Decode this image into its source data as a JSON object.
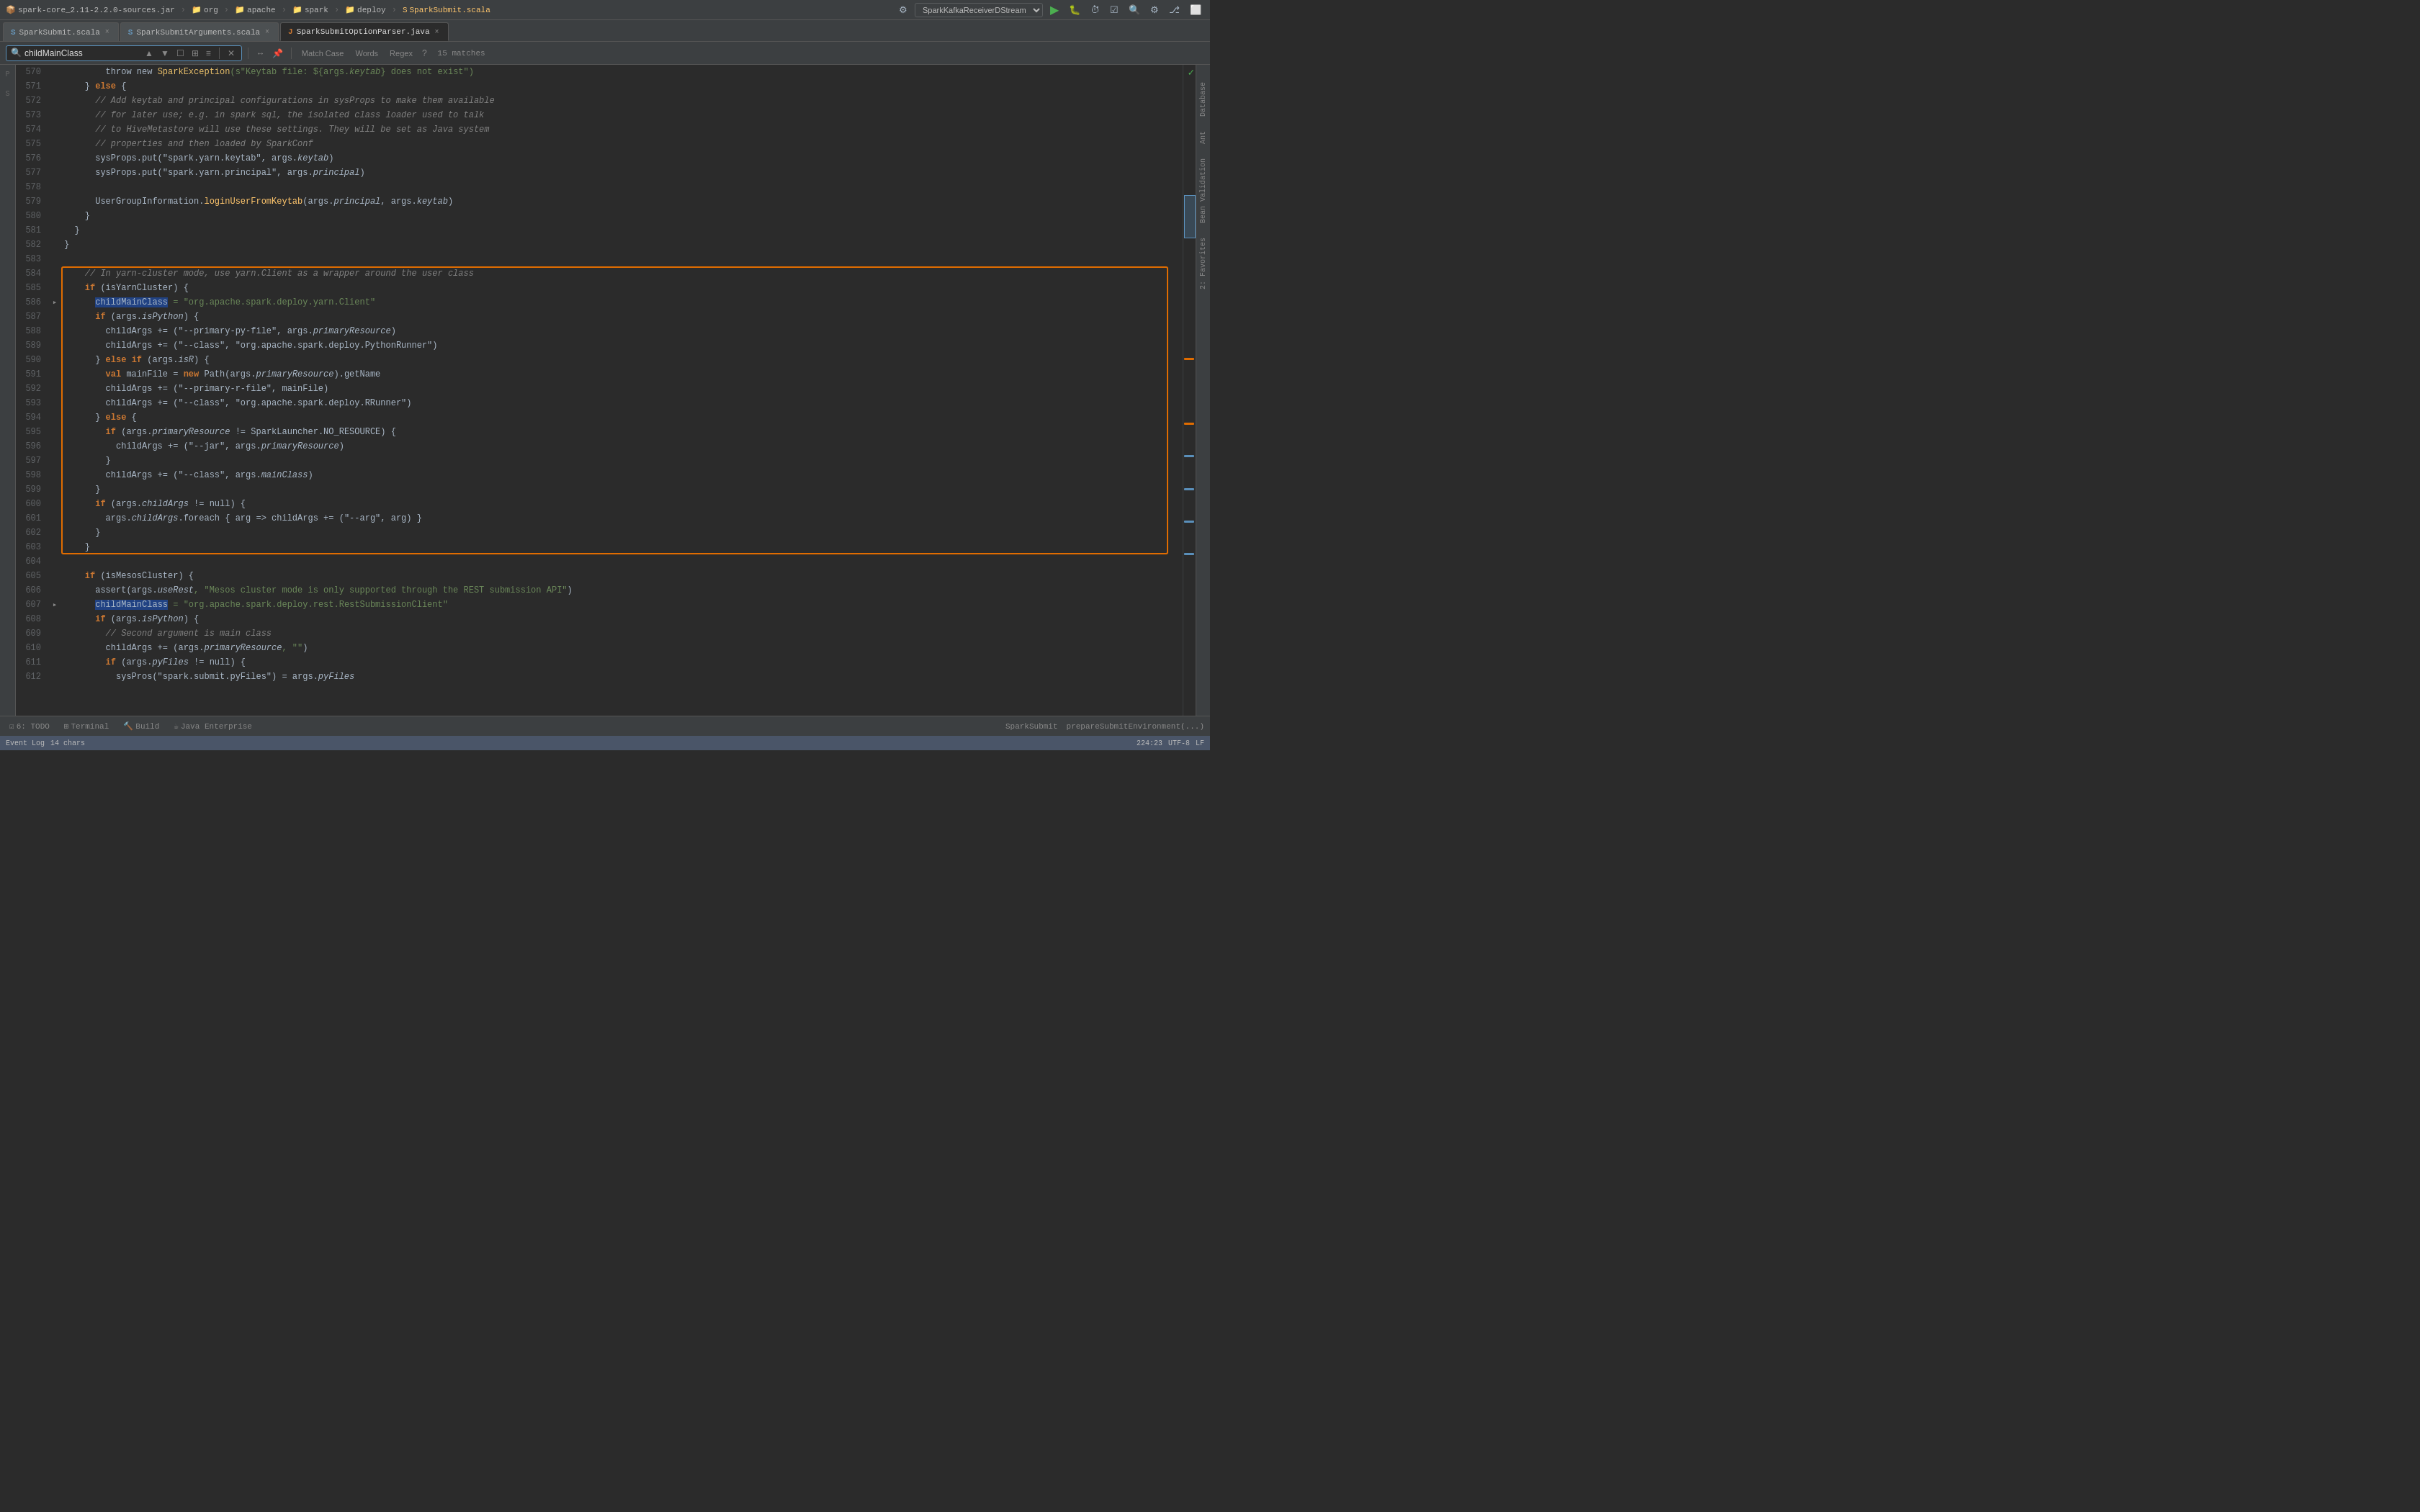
{
  "topbar": {
    "breadcrumbs": [
      {
        "label": "spark-core_2.11-2.2.0-sources.jar",
        "icon": "jar"
      },
      {
        "label": "org",
        "icon": "folder"
      },
      {
        "label": "apache",
        "icon": "folder"
      },
      {
        "label": "spark",
        "icon": "folder"
      },
      {
        "label": "deploy",
        "icon": "folder"
      },
      {
        "label": "SparkSubmit.scala",
        "icon": "scala"
      }
    ],
    "run_config": "SparkKafkaReceiverDStream"
  },
  "tabs": [
    {
      "label": "SparkSubmit.scala",
      "active": false,
      "icon": "S"
    },
    {
      "label": "SparkSubmitArguments.scala",
      "active": false,
      "icon": "S"
    },
    {
      "label": "SparkSubmitOptionParser.java",
      "active": true,
      "icon": "J"
    }
  ],
  "search": {
    "query": "childMainClass",
    "placeholder": "childMainClass",
    "match_case_label": "Match Case",
    "words_label": "Words",
    "regex_label": "Regex",
    "regex_help": "?",
    "matches": "15 matches"
  },
  "lines": [
    {
      "num": 570,
      "fold": false,
      "code": [
        {
          "t": "        throw new ",
          "c": "id"
        },
        {
          "t": "SparkException",
          "c": "cls"
        },
        {
          "t": "(s\"Keytab file: ${args.",
          "c": "str"
        },
        {
          "t": "keytab",
          "c": "it str"
        },
        {
          "t": "} does not exist\")",
          "c": "str"
        }
      ]
    },
    {
      "num": 571,
      "fold": false,
      "code": [
        {
          "t": "    } else {",
          "c": "id"
        }
      ]
    },
    {
      "num": 572,
      "fold": false,
      "code": [
        {
          "t": "      // Add keytab and principal configurations in sysProps to make them available",
          "c": "cm"
        }
      ]
    },
    {
      "num": 573,
      "fold": false,
      "code": [
        {
          "t": "      // for later use; e.g. in spark sql, the isolated class loader used to talk",
          "c": "cm"
        }
      ]
    },
    {
      "num": 574,
      "fold": false,
      "code": [
        {
          "t": "      // to HiveMetastore will use these settings. They will be set as Java system",
          "c": "cm"
        }
      ]
    },
    {
      "num": 575,
      "fold": false,
      "code": [
        {
          "t": "      // properties and then loaded by SparkConf",
          "c": "cm"
        }
      ]
    },
    {
      "num": 576,
      "fold": false,
      "code": [
        {
          "t": "      sysProps.put(\"spark.yarn.keytab\", args.",
          "c": "id"
        },
        {
          "t": "keytab",
          "c": "it"
        }
      ],
      "extra": "keytab"
    },
    {
      "num": 577,
      "fold": false,
      "code": [
        {
          "t": "      sysProps.put(\"spark.yarn.principal\", args.",
          "c": "id"
        },
        {
          "t": "principal",
          "c": "it"
        }
      ],
      "extra": "principal"
    },
    {
      "num": 578,
      "fold": false,
      "code": []
    },
    {
      "num": 579,
      "fold": false,
      "code": [
        {
          "t": "      UserGroupInformation.",
          "c": "id"
        },
        {
          "t": "loginUserFromKeytab",
          "c": "fn"
        },
        {
          "t": "(args.",
          "c": "id"
        },
        {
          "t": "principal",
          "c": "it"
        },
        {
          "t": ", args.",
          "c": "id"
        },
        {
          "t": "keytab",
          "c": "it"
        },
        {
          "t": ")",
          "c": "id"
        }
      ]
    },
    {
      "num": 580,
      "fold": false,
      "code": [
        {
          "t": "    }",
          "c": "id"
        }
      ]
    },
    {
      "num": 581,
      "fold": false,
      "code": [
        {
          "t": "  }",
          "c": "id"
        }
      ]
    },
    {
      "num": 582,
      "fold": false,
      "code": [
        {
          "t": "}",
          "c": "id"
        }
      ]
    },
    {
      "num": 583,
      "fold": false,
      "code": []
    },
    {
      "num": 584,
      "fold": false,
      "code": [
        {
          "t": "    // In yarn-cluster mode, use yarn.Client as a wrapper around the user class",
          "c": "cm"
        }
      ],
      "outline_start": true
    },
    {
      "num": 585,
      "fold": false,
      "code": [
        {
          "t": "    ",
          "c": "id"
        },
        {
          "t": "if",
          "c": "kw"
        },
        {
          "t": " (isYarnCluster) {",
          "c": "id"
        }
      ]
    },
    {
      "num": 586,
      "fold": true,
      "code": [
        {
          "t": "      ",
          "c": "id"
        },
        {
          "t": "childMainClass",
          "c": "hl"
        },
        {
          "t": " = \"org.apache.spark.deploy.yarn.Client\"",
          "c": "str"
        }
      ]
    },
    {
      "num": 587,
      "fold": false,
      "code": [
        {
          "t": "      ",
          "c": "id"
        },
        {
          "t": "if",
          "c": "kw"
        },
        {
          "t": " (args.",
          "c": "id"
        },
        {
          "t": "isPython",
          "c": "it"
        },
        {
          "t": ") {",
          "c": "id"
        }
      ]
    },
    {
      "num": 588,
      "fold": false,
      "code": [
        {
          "t": "        childArgs += (\"--primary-py-file\", args.",
          "c": "id"
        },
        {
          "t": "primaryResource",
          "c": "it"
        },
        {
          "t": ")",
          "c": "id"
        }
      ]
    },
    {
      "num": 589,
      "fold": false,
      "code": [
        {
          "t": "        childArgs += (\"--class\", \"org.apache.spark.deploy.PythonRunner\")",
          "c": "id"
        }
      ]
    },
    {
      "num": 590,
      "fold": false,
      "code": [
        {
          "t": "      } ",
          "c": "id"
        },
        {
          "t": "else",
          "c": "kw"
        },
        {
          "t": " ",
          "c": "id"
        },
        {
          "t": "if",
          "c": "kw"
        },
        {
          "t": " (args.",
          "c": "id"
        },
        {
          "t": "isR",
          "c": "it"
        },
        {
          "t": ") {",
          "c": "id"
        }
      ]
    },
    {
      "num": 591,
      "fold": false,
      "code": [
        {
          "t": "        ",
          "c": "id"
        },
        {
          "t": "val",
          "c": "kw"
        },
        {
          "t": " mainFile = ",
          "c": "id"
        },
        {
          "t": "new",
          "c": "kw"
        },
        {
          "t": " Path(args.",
          "c": "id"
        },
        {
          "t": "primaryResource",
          "c": "it"
        },
        {
          "t": ").getName",
          "c": "id"
        }
      ]
    },
    {
      "num": 592,
      "fold": false,
      "code": [
        {
          "t": "        childArgs += (\"--primary-r-file\", mainFile)",
          "c": "id"
        }
      ]
    },
    {
      "num": 593,
      "fold": false,
      "code": [
        {
          "t": "        childArgs += (\"--class\", \"org.apache.spark.deploy.RRunner\")",
          "c": "id"
        }
      ]
    },
    {
      "num": 594,
      "fold": false,
      "code": [
        {
          "t": "      } ",
          "c": "id"
        },
        {
          "t": "else",
          "c": "kw"
        },
        {
          "t": " {",
          "c": "id"
        }
      ]
    },
    {
      "num": 595,
      "fold": false,
      "code": [
        {
          "t": "        ",
          "c": "id"
        },
        {
          "t": "if",
          "c": "kw"
        },
        {
          "t": " (args.",
          "c": "id"
        },
        {
          "t": "primaryResource",
          "c": "it"
        },
        {
          "t": " != SparkLauncher.",
          "c": "id"
        },
        {
          "t": "NO_RESOURCE",
          "c": "id"
        },
        {
          "t": ") {",
          "c": "id"
        }
      ]
    },
    {
      "num": 596,
      "fold": false,
      "code": [
        {
          "t": "          childArgs += (\"--jar\", args.",
          "c": "id"
        },
        {
          "t": "primaryResource",
          "c": "it"
        },
        {
          "t": ")",
          "c": "id"
        }
      ]
    },
    {
      "num": 597,
      "fold": false,
      "code": [
        {
          "t": "        }",
          "c": "id"
        }
      ]
    },
    {
      "num": 598,
      "fold": false,
      "code": [
        {
          "t": "        childArgs += (\"--class\", args.",
          "c": "id"
        },
        {
          "t": "mainClass",
          "c": "it"
        },
        {
          "t": ")",
          "c": "id"
        }
      ]
    },
    {
      "num": 599,
      "fold": false,
      "code": [
        {
          "t": "      }",
          "c": "id"
        }
      ]
    },
    {
      "num": 600,
      "fold": false,
      "code": [
        {
          "t": "      ",
          "c": "id"
        },
        {
          "t": "if",
          "c": "kw"
        },
        {
          "t": " (args.",
          "c": "id"
        },
        {
          "t": "childArgs",
          "c": "it"
        },
        {
          "t": " != null) {",
          "c": "id"
        }
      ]
    },
    {
      "num": 601,
      "fold": false,
      "code": [
        {
          "t": "        args.",
          "c": "id"
        },
        {
          "t": "childArgs",
          "c": "it"
        },
        {
          "t": ".foreach { arg => childArgs += (\"--arg\", arg) }",
          "c": "id"
        }
      ]
    },
    {
      "num": 602,
      "fold": false,
      "code": [
        {
          "t": "      }",
          "c": "id"
        }
      ]
    },
    {
      "num": 603,
      "fold": false,
      "code": [
        {
          "t": "    }",
          "c": "id"
        }
      ],
      "outline_end": true
    },
    {
      "num": 604,
      "fold": false,
      "code": []
    },
    {
      "num": 605,
      "fold": false,
      "code": [
        {
          "t": "    ",
          "c": "id"
        },
        {
          "t": "if",
          "c": "kw"
        },
        {
          "t": " (isMesosCluster) {",
          "c": "id"
        }
      ]
    },
    {
      "num": 606,
      "fold": false,
      "code": [
        {
          "t": "      assert(args.",
          "c": "id"
        },
        {
          "t": "useRest",
          "c": "it"
        },
        {
          "t": ", \"Mesos cluster mode is only supported through the REST submission API\")",
          "c": "str"
        }
      ]
    },
    {
      "num": 607,
      "fold": true,
      "code": [
        {
          "t": "      ",
          "c": "id"
        },
        {
          "t": "childMainClass",
          "c": "hl"
        },
        {
          "t": " = \"org.apache.spark.deploy.rest.RestSubmissionClient\"",
          "c": "str"
        }
      ]
    },
    {
      "num": 608,
      "fold": false,
      "code": [
        {
          "t": "      ",
          "c": "id"
        },
        {
          "t": "if",
          "c": "kw"
        },
        {
          "t": " (args.",
          "c": "id"
        },
        {
          "t": "isPython",
          "c": "it"
        },
        {
          "t": ") {",
          "c": "id"
        }
      ]
    },
    {
      "num": 609,
      "fold": false,
      "code": [
        {
          "t": "        // Second argument is main class",
          "c": "cm"
        }
      ]
    },
    {
      "num": 610,
      "fold": false,
      "code": [
        {
          "t": "        childArgs += (args.",
          "c": "id"
        },
        {
          "t": "primaryResource",
          "c": "it"
        },
        {
          "t": ", \"\")",
          "c": "str"
        }
      ]
    },
    {
      "num": 611,
      "fold": false,
      "code": [
        {
          "t": "        ",
          "c": "id"
        },
        {
          "t": "if",
          "c": "kw"
        },
        {
          "t": " (args.",
          "c": "id"
        },
        {
          "t": "pyFiles",
          "c": "it"
        },
        {
          "t": " != null) {",
          "c": "id"
        }
      ]
    },
    {
      "num": 612,
      "fold": false,
      "code": [
        {
          "t": "          sysPros(\"spark.submit.pyFiles\") = args.",
          "c": "id"
        },
        {
          "t": "pyFiles",
          "c": "it"
        }
      ]
    }
  ],
  "bottom": {
    "todo_label": "6: TODO",
    "terminal_label": "Terminal",
    "build_label": "Build",
    "java_enterprise_label": "Java Enterprise"
  },
  "statusbar": {
    "method": "prepareSubmitEnvironment(...)",
    "class": "SparkSubmit",
    "position": "224:23",
    "encoding": "UTF-8",
    "lf": "LF",
    "event_log": "Event Log",
    "chars": "14 chars"
  },
  "right_panel_labels": [
    "Database",
    "Ant",
    "Bean Validation",
    "2: Favorites"
  ],
  "colors": {
    "accent": "#5a8fba",
    "orange": "#e06c00",
    "green": "#4CAF50",
    "bg": "#2b2b2b",
    "panel": "#3c3f41"
  }
}
